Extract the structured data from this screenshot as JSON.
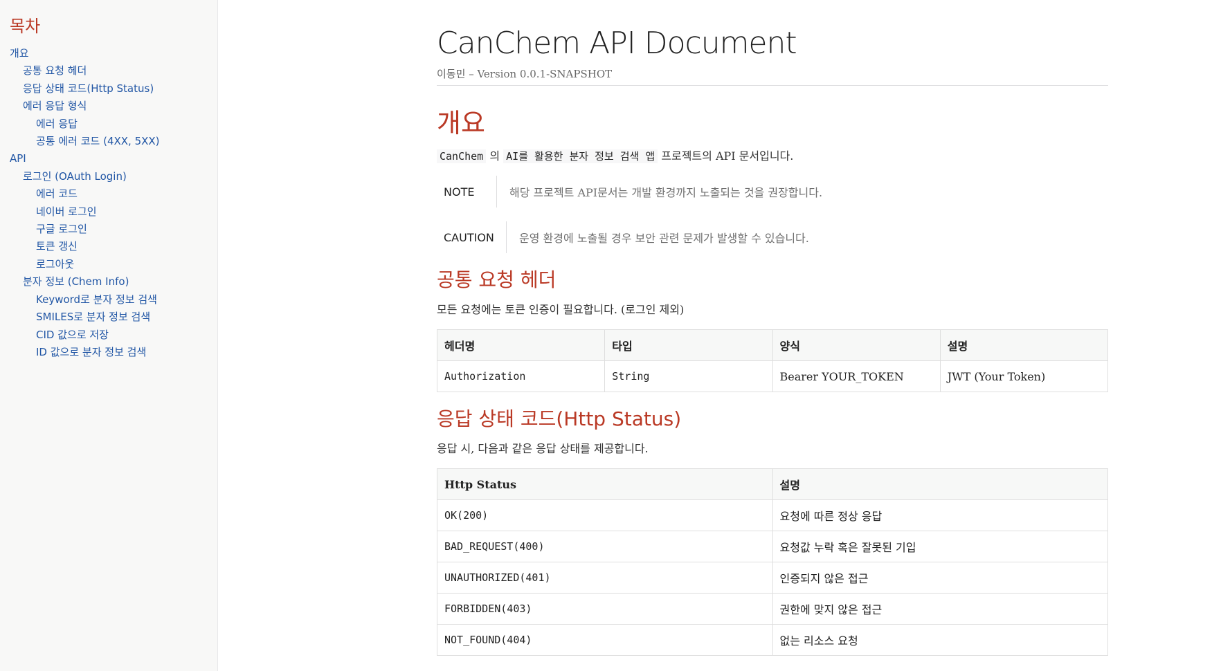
{
  "toc": {
    "title": "목차",
    "items": [
      {
        "label": "개요",
        "level": 1
      },
      {
        "label": "공통 요청 헤더",
        "level": 2
      },
      {
        "label": "응답 상태 코드(Http Status)",
        "level": 2
      },
      {
        "label": "에러 응답 형식",
        "level": 2
      },
      {
        "label": "에러 응답",
        "level": 3
      },
      {
        "label": "공통 에러 코드 (4XX, 5XX)",
        "level": 3
      },
      {
        "label": "API",
        "level": 1
      },
      {
        "label": "로그인 (OAuth Login)",
        "level": 2
      },
      {
        "label": "에러 코드",
        "level": 3
      },
      {
        "label": "네이버 로그인",
        "level": 3
      },
      {
        "label": "구글 로그인",
        "level": 3
      },
      {
        "label": "토큰 갱신",
        "level": 3
      },
      {
        "label": "로그아웃",
        "level": 3
      },
      {
        "label": "분자 정보 (Chem Info)",
        "level": 2
      },
      {
        "label": "Keyword로 분자 정보 검색",
        "level": 3
      },
      {
        "label": "SMILES로 분자 정보 검색",
        "level": 3
      },
      {
        "label": "CID 값으로 저장",
        "level": 3
      },
      {
        "label": "ID 값으로 분자 정보 검색",
        "level": 3
      }
    ]
  },
  "doc": {
    "title": "CanChem API Document",
    "author": "이동민",
    "separator": "–",
    "version": "Version 0.0.1-SNAPSHOT"
  },
  "overview": {
    "heading": "개요",
    "intro_code1": "CanChem",
    "intro_text1": "의",
    "intro_code2": "AI를 활용한 분자 정보 검색 앱",
    "intro_text2": "프로젝트의 API 문서입니다.",
    "note_label": "NOTE",
    "note_text": "해당 프로젝트 API문서는 개발 환경까지 노출되는 것을 권장합니다.",
    "caution_label": "CAUTION",
    "caution_text": "운영 환경에 노출될 경우 보안 관련 문제가 발생할 수 있습니다."
  },
  "headers_section": {
    "heading": "공통 요청 헤더",
    "desc": "모든 요청에는 토큰 인증이 필요합니다. (로그인 제외)",
    "columns": [
      "헤더명",
      "타입",
      "양식",
      "설명"
    ],
    "rows": [
      [
        "Authorization",
        "String",
        "Bearer YOUR_TOKEN",
        "JWT (Your Token)"
      ]
    ]
  },
  "status_section": {
    "heading": "응답 상태 코드(Http Status)",
    "desc": "응답 시, 다음과 같은 응답 상태를 제공합니다.",
    "columns": [
      "Http Status",
      "설명"
    ],
    "rows": [
      [
        "OK(200)",
        "요청에 따른 정상 응답"
      ],
      [
        "BAD_REQUEST(400)",
        "요청값 누락 혹은 잘못된 기입"
      ],
      [
        "UNAUTHORIZED(401)",
        "인증되지 않은 접근"
      ],
      [
        "FORBIDDEN(403)",
        "권한에 맞지 않은 접근"
      ],
      [
        "NOT_FOUND(404)",
        "없는 리소스 요청"
      ]
    ]
  }
}
